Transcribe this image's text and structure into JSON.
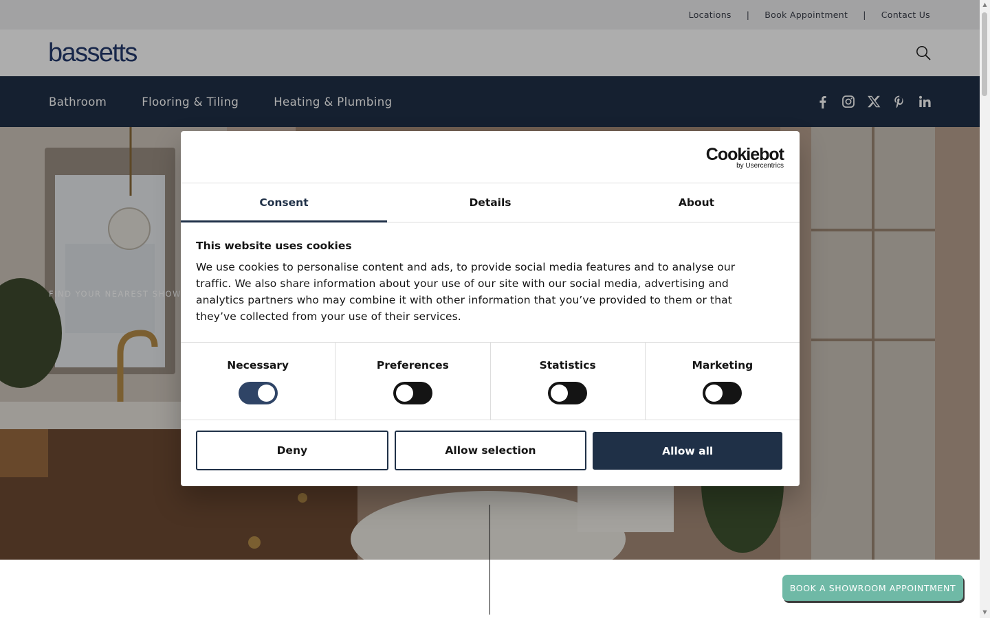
{
  "topbar": {
    "links": [
      "Locations",
      "Book Appointment",
      "Contact Us"
    ],
    "separator": "|"
  },
  "header": {
    "logo": "bassetts",
    "search_icon": "search-icon"
  },
  "nav": {
    "items": [
      "Bathroom",
      "Flooring & Tiling",
      "Heating & Plumbing"
    ],
    "social_icons": [
      "facebook-icon",
      "instagram-icon",
      "x-icon",
      "pinterest-icon",
      "linkedin-icon"
    ],
    "background": "#1f3047"
  },
  "hero": {
    "kicker": "FIND YOUR NEAREST SHOW"
  },
  "cookie_dialog": {
    "brand_main": "Cookiebot",
    "brand_sub": "by Usercentrics",
    "tabs": [
      "Consent",
      "Details",
      "About"
    ],
    "active_tab": "Consent",
    "heading": "This website uses cookies",
    "body": "We use cookies to personalise content and ads, to provide social media features and to analyse our traffic. We also share information about your use of our site with our social media, advertising and analytics partners who may combine it with other information that you’ve provided to them or that they’ve collected from your use of their services.",
    "toggles": [
      {
        "label": "Necessary",
        "on": true
      },
      {
        "label": "Preferences",
        "on": false
      },
      {
        "label": "Statistics",
        "on": false
      },
      {
        "label": "Marketing",
        "on": false
      }
    ],
    "buttons": {
      "deny": "Deny",
      "allow_selection": "Allow selection",
      "allow_all": "Allow all"
    }
  },
  "book_button": {
    "label": "BOOK A SHOWROOM APPOINTMENT",
    "color": "#6fb9a6"
  }
}
